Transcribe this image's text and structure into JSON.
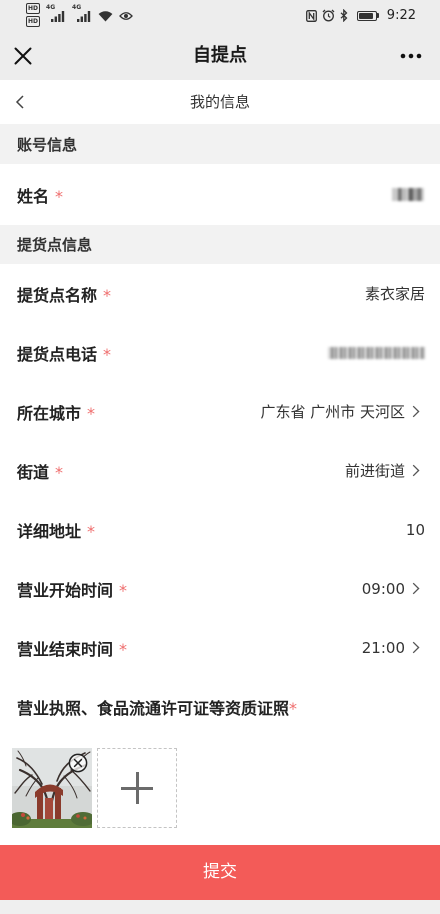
{
  "status_bar": {
    "sim_badges": [
      "HD",
      "HD"
    ],
    "network_labels": [
      "4G",
      "4G"
    ],
    "time": "9:22",
    "battery_level": 0.9,
    "icons": [
      "signal-icon",
      "wifi-icon",
      "eye-icon",
      "nfc-icon",
      "alarm-icon",
      "bluetooth-icon",
      "battery-icon"
    ]
  },
  "nav_bar": {
    "title": "自提点",
    "left_icon": "close-icon",
    "right_icon": "more-icon"
  },
  "sub_header": {
    "title": "我的信息",
    "back_icon": "chevron-left-icon"
  },
  "form": {
    "required_mark": "*",
    "account_section": {
      "title": "账号信息",
      "rows": [
        {
          "label": "姓名"
        }
      ]
    },
    "pickup_section": {
      "title": "提货点信息",
      "rows": [
        {
          "label": "提货点名称",
          "value": "素衣家居"
        },
        {
          "label": "提货点电话"
        },
        {
          "label": "所在城市",
          "value": "广东省 广州市 天河区",
          "icon": "chevron-right-icon"
        },
        {
          "label": "街道",
          "value": "前进街道",
          "icon": "chevron-right-icon"
        },
        {
          "label": "详细地址",
          "value": "10"
        },
        {
          "label": "营业开始时间",
          "value": "09:00",
          "icon": "chevron-right-icon"
        },
        {
          "label": "营业结束时间",
          "value": "21:00",
          "icon": "chevron-right-icon"
        }
      ]
    },
    "license": {
      "label": "营业执照、食品流通许可证等资质证照",
      "remove_icon": "close-circle-icon",
      "add_icon": "plus-icon"
    }
  },
  "submit": {
    "label": "提交"
  },
  "colors": {
    "bar_background": "#ededed",
    "section_background": "#f2f2f2",
    "required": "#ef6d6d",
    "submit_button": "#f35b58"
  }
}
